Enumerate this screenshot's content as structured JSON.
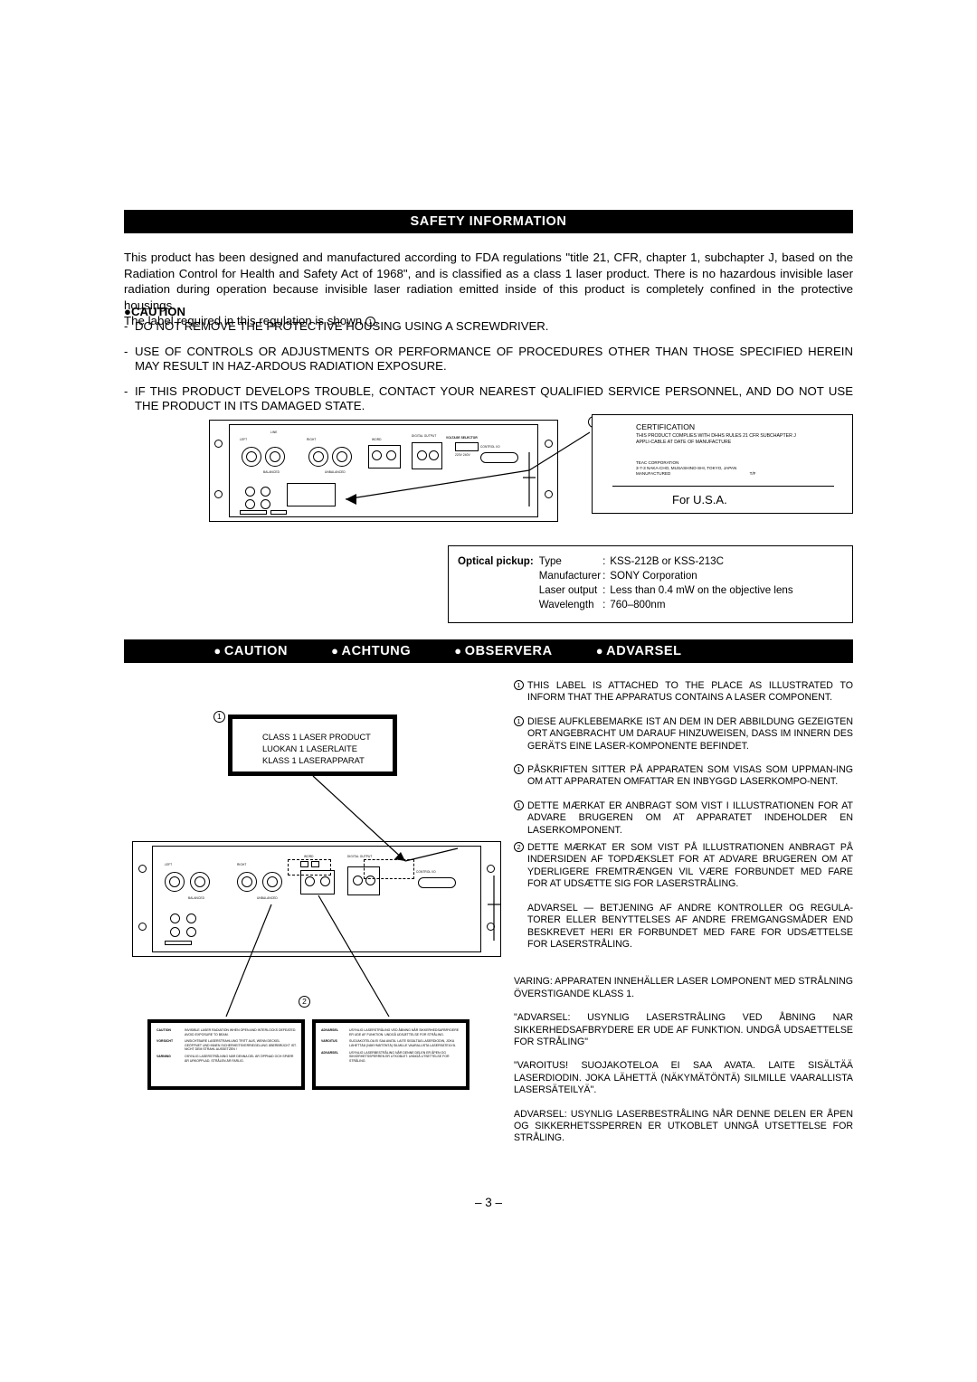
{
  "headers": {
    "safety": "SAFETY INFORMATION",
    "caution_bar": [
      "CAUTION",
      "ACHTUNG",
      "OBSERVERA",
      "ADVARSEL"
    ]
  },
  "intro": {
    "paragraph": "This product has been designed and manufactured according to FDA regulations \"title 21, CFR, chapter 1, subchapter J, based on the Radiation Control for Health and Safety Act of 1968\", and is classified as a class 1 laser product. There is no hazardous invisible laser radiation during operation because invisible laser radiation emitted inside of this product is completely confined in the protective housings.",
    "label_line": "The label required in this regulation is shown",
    "label_line_num": "1",
    "label_line_end": "."
  },
  "caution": {
    "heading": "CAUTION",
    "bullet": "●",
    "items": [
      "DO NOT REMOVE THE PROTECTIVE HOUSING USING A SCREWDRIVER.",
      "USE OF CONTROLS OR ADJUSTMENTS OR PERFORMANCE OF PROCEDURES OTHER THAN THOSE SPECIFIED HEREIN MAY RESULT IN HAZ-ARDOUS RADIATION EXPOSURE.",
      "IF THIS PRODUCT DEVELOPS TROUBLE, CONTACT YOUR NEAREST QUALIFIED SERVICE PERSONNEL, AND DO NOT USE THE PRODUCT IN ITS DAMAGED STATE."
    ],
    "dash": "-"
  },
  "certification": {
    "callout_num": "1",
    "title": "CERTIFICATION",
    "body": "THIS PRODUCT COMPLIES WITH DHHS RULES 21 CFR SUBCHAPTER J APPLI-CABLE AT DATE OF MANUFACTURE",
    "company": "TEAC CORPORATION",
    "address": "3-7-3 NAKA-CHO, MUSASHINO-SHI, TOKYO, JAPAN",
    "manufactured": "MANUFACTURED",
    "manufactured_code": "T/F",
    "for_usa": "For U.S.A."
  },
  "optical_pickup": {
    "label": "Optical pickup:",
    "rows": [
      {
        "key": "Type",
        "sep": ":",
        "value": "KSS-212B or KSS-213C"
      },
      {
        "key": "Manufacturer",
        "sep": ":",
        "value": "SONY Corporation"
      },
      {
        "key": "Laser output",
        "sep": ":",
        "value": "Less than 0.4 mW on the objective lens"
      },
      {
        "key": "Wavelength",
        "sep": ":",
        "value": "760–800nm"
      }
    ]
  },
  "class1_label": {
    "callout_num": "1",
    "lines": [
      "CLASS 1 LASER PRODUCT",
      "LUOKAN 1 LASERLAITE",
      "KLASS 1 LASERAPPARAT"
    ]
  },
  "warning_labels": {
    "callout_num": "2",
    "left": [
      {
        "lang": "CAUTION",
        "text": "INVISIBLE LASER RADIATION WHEN OPEN AND INTERLOCKS DEFEATED. AVOID EXPOSURE TO BEAM."
      },
      {
        "lang": "VORSICHT",
        "text": "UNSICHTBARE LASERSTRAHLUNG TRITT AUS, WENN DECKEL GEÖFFNET UND INNEN SICHERHEITSVERRIEGELUNG ÜBERBRÜCKT IST. NICHT DEM STRAHL AUSSETZEN !"
      },
      {
        "lang": "VARNING",
        "text": "OSYNLIG LASERSTRÅLNING NÄR DENNA DEL ÄR ÖPPNAD OCH SPÄRR ÄR URKOPPLAD. STRÅLEN ÄR FARLIG."
      }
    ],
    "right": [
      {
        "lang": "ADVARSEL",
        "text": "USYNLIG LASERSTRÅLING VED ÅBNING NÅR SIKKERHEDSAFBRYDERE ER UDE AF FUNKTION. UNDGÅ UDSÆTTELSE FOR STRÅLING."
      },
      {
        "lang": "VAROITUS",
        "text": "SUOJAKOTELOA EI SAA AVATA. LAITE SISÄLTÄÄ LASERDIODIN, JOKA LÄHETTÄÄ (NÄKYMÄTÖNTÄ) SILMILLE VAARALLISTA LASERSÄTEILYÄ."
      },
      {
        "lang": "ADVARSEL",
        "text": "USYNLIG LASERBESTRÅLING NÅR DENNE DELEN ER ÅPEN OG SIKKERHETSSPERREN ER UTKOBLET. UNNGÅ UTSETTELSE FOR STRÅLING."
      }
    ]
  },
  "multilingual": [
    {
      "num": "1",
      "text": "THIS LABEL IS ATTACHED TO THE PLACE AS ILLUSTRATED TO INFORM THAT THE APPARATUS CONTAINS A LASER COMPONENT."
    },
    {
      "num": "1",
      "text": "DIESE AUFKLEBEMARKE IST AN DEM IN DER ABBILDUNG GEZEIGTEN ORT ANGEBRACHT UM DARAUF HINZUWEISEN, DASS IM INNERN DES GERÄTS EINE LASER-KOMPONENTE BEFINDET."
    },
    {
      "num": "1",
      "text": "PÅSKRIFTEN SITTER PÅ APPARATEN SOM VISAS SOM UPPMAN-ING OM ATT APPARATEN OMFATTAR EN INBYGGD LASERKOMPO-NENT."
    },
    {
      "num": "1",
      "text": "DETTE MÆRKAT ER ANBRAGT SOM VIST I ILLUSTRATIONEN FOR AT ADVARE BRUGEREN OM AT APPARATET INDEHOLDER EN LASERKOMPONENT."
    },
    {
      "num": "2",
      "text": "DETTE MÆRKAT ER SOM VIST PÅ ILLUSTRATIONEN ANBRAGT PÅ INDERSIDEN AF TOPDÆKSLET FOR AT ADVARE BRUGEREN OM AT YDERLIGERE FREMTRÆNGEN VIL VÆRE FORBUNDET MED FARE FOR AT UDSÆTTE SIG FOR LASERSTRÅLING."
    }
  ],
  "multilingual_plain": [
    "ADVARSEL — BETJENING AF ANDRE KONTROLLER OG REGULA-TORER ELLER BENYTTELSES AF ANDRE FREMGANGSMÅDER END BESKREVET HERI ER FORBUNDET MED FARE FOR UDSÆTTELSE FOR LASERSTRÅLING."
  ],
  "multilingual_tail": [
    "VARING: APPARATEN INNEHÄLLER LASER LOMPONENT MED STRÅLNING ÖVERSTIGANDE KLASS 1.",
    "\"ADVARSEL: USYNLIG LASERSTRÅLING VED ÅBNING NAR SIKKERHEDSAFBRYDERE ER UDE AF FUNKTION. UNDGÅ UDSAETTELSE FOR STRÅLING\"",
    "\"VAROITUS! SUOJAKOTELOA EI SAA AVATA. LAITE SISÄLTÄÄ LASERDIODIN. JOKA LÄHETTÄ (NÄKYMÄTÖNTÄ) SILMILLE VAARALLISTA LASERSÄTEILYÄ\".",
    "ADVARSEL: USYNLIG LASERBESTRÅLING NÅR DENNE DELEN ER ÅPEN OG SIKKERHETSSPERREN ER UTKOBLET UNNGÅ UTSETTELSE FOR STRÅLING."
  ],
  "unit_top_labels": {
    "voltage_selector": "VOLTAGE SELECTOR",
    "voltage_values": "220V 240V",
    "control_io": "CONTROL I/O",
    "digital_out": "DIGITAL OUTPUT",
    "left": "LEFT",
    "right": "RIGHT",
    "line": "LINE",
    "balanced": "BALANCED",
    "unbalanced": "UNBALANCED",
    "word": "WORD"
  },
  "page_number": "– 3 –"
}
